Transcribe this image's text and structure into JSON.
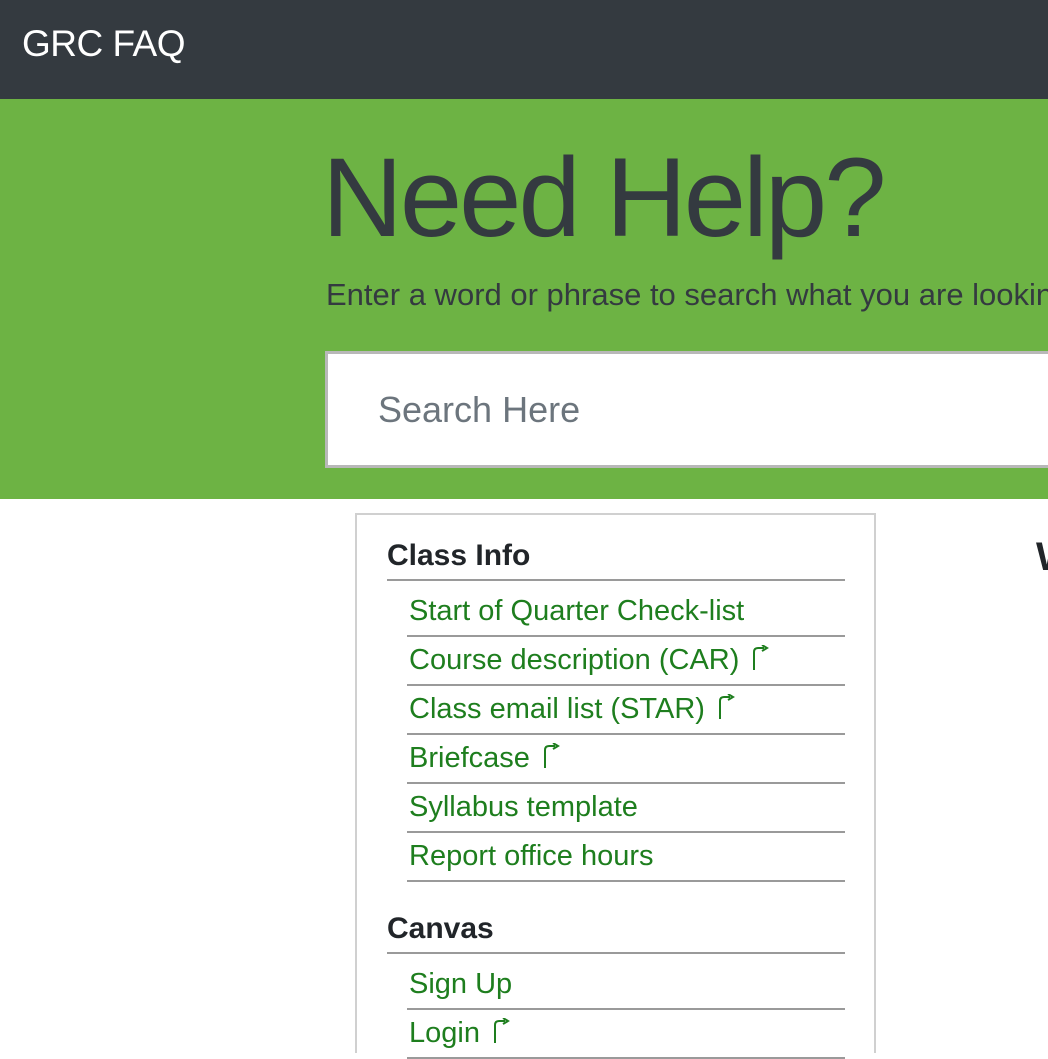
{
  "navbar": {
    "brand": "GRC FAQ"
  },
  "hero": {
    "title": "Need Help?",
    "subtitle": "Enter a word or phrase to search what you are looking for",
    "search_placeholder": "Search Here"
  },
  "sidebar": {
    "sections": [
      {
        "title": "Class Info",
        "links": [
          {
            "label": "Start of Quarter Check-list",
            "external": false
          },
          {
            "label": "Course description (CAR)",
            "external": true
          },
          {
            "label": "Class email list (STAR)",
            "external": true
          },
          {
            "label": "Briefcase",
            "external": true
          },
          {
            "label": "Syllabus template",
            "external": false
          },
          {
            "label": "Report office hours",
            "external": false
          }
        ]
      },
      {
        "title": "Canvas",
        "links": [
          {
            "label": "Sign Up",
            "external": false
          },
          {
            "label": "Login",
            "external": true
          }
        ]
      }
    ]
  },
  "main": {
    "heading_partial": "W"
  },
  "colors": {
    "navbar_bg": "#343a40",
    "hero_bg": "#6db344",
    "link": "#1e7e1e",
    "text_dark": "#343a40"
  }
}
